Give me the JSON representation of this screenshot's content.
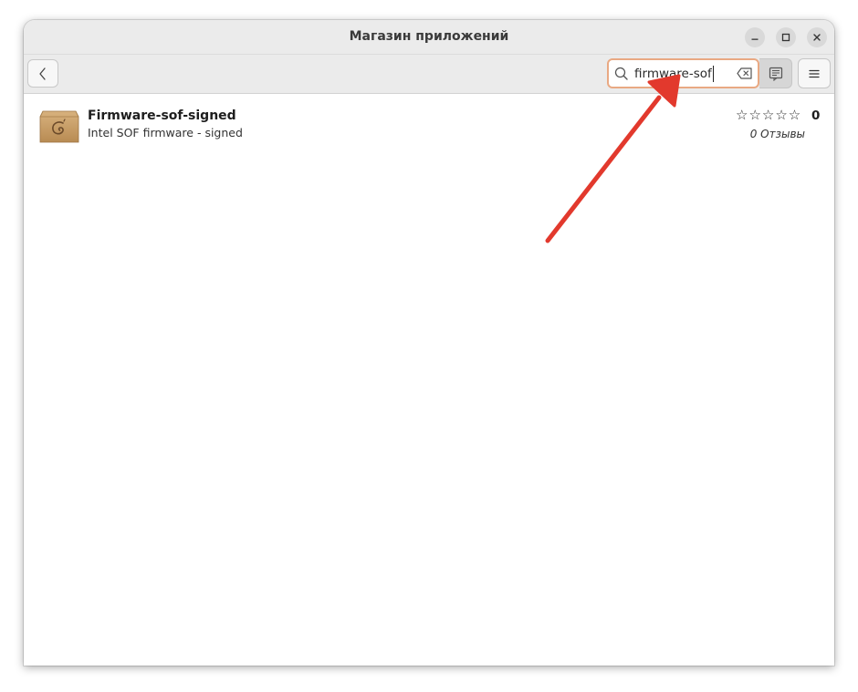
{
  "window": {
    "title": "Магазин приложений"
  },
  "titlebar_buttons": {
    "minimize_icon": "minimize-icon",
    "maximize_icon": "maximize-icon",
    "close_icon": "close-icon"
  },
  "headerbar": {
    "back_icon": "chevron-left-icon",
    "search": {
      "value": "firmware-sof",
      "placeholder": "",
      "search_icon": "magnifier-icon",
      "clear_icon": "backspace-clear-icon"
    },
    "mode_icon": "list-view-icon",
    "menu_icon": "hamburger-menu-icon"
  },
  "results": [
    {
      "icon": "debian-package-icon",
      "name": "Firmware-sof-signed",
      "summary": "Intel SOF firmware - signed",
      "stars": "☆☆☆☆☆",
      "stars_filled": 0,
      "rating_count": "0",
      "reviews": "0 Отзывы"
    }
  ],
  "colors": {
    "titlebar_bg": "#ebebeb",
    "search_focus_border": "#e9a983",
    "annotation_arrow": "#e2392d",
    "package_box": "#c9a06a"
  }
}
